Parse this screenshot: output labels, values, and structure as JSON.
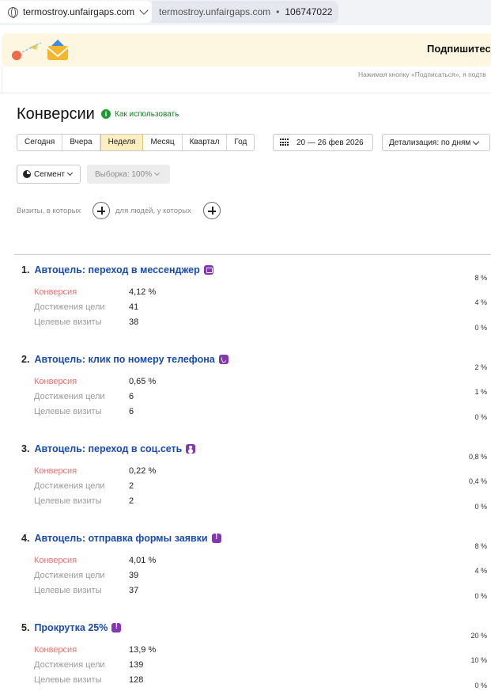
{
  "topbar": {
    "site": "termostroy.unfairgaps.com",
    "counter_site": "termostroy.unfairgaps.com",
    "counter_sep": "•",
    "counter_id": "106747022"
  },
  "banner": {
    "title": "Подпишитесь",
    "note": "Нажимая кнопку «Подписаться», я подтв"
  },
  "page": {
    "title": "Конверсии",
    "howto": "Как использовать",
    "howto_icon": "i"
  },
  "periods": [
    {
      "label": "Сегодня",
      "active": false
    },
    {
      "label": "Вчера",
      "active": false
    },
    {
      "label": "Неделя",
      "active": true
    },
    {
      "label": "Месяц",
      "active": false
    },
    {
      "label": "Квартал",
      "active": false
    },
    {
      "label": "Год",
      "active": false
    }
  ],
  "date_range": "20 — 26 фев 2026",
  "detail": "Детализация: по дням",
  "segment_label": "Сегмент",
  "sample_label": "Выборка: 100%",
  "filters": {
    "visits_text": "Визиты, в которых",
    "people_text": "для людей, у которых"
  },
  "metric_labels": {
    "conversion": "Конверсия",
    "reaches": "Достижения цели",
    "visits": "Целевые визиты"
  },
  "goals": [
    {
      "num": "1.",
      "name": "Автоцель: переход в мессенджер",
      "icon": "message-icon",
      "conversion": "4,12 %",
      "reaches": "41",
      "visits": "38",
      "axis": [
        "8 %",
        "4 %",
        "0 %"
      ]
    },
    {
      "num": "2.",
      "name": "Автоцель: клик по номеру телефона",
      "icon": "phone-icon",
      "conversion": "0,65 %",
      "reaches": "6",
      "visits": "6",
      "axis": [
        "2 %",
        "1 %",
        "0 %"
      ]
    },
    {
      "num": "3.",
      "name": "Автоцель: переход в соц.сеть",
      "icon": "user-icon",
      "conversion": "0,22 %",
      "reaches": "2",
      "visits": "2",
      "axis": [
        "0,8 %",
        "0,4 %",
        "0 %"
      ]
    },
    {
      "num": "4.",
      "name": "Автоцель: отправка формы заявки",
      "icon": "warning-icon",
      "conversion": "4,01 %",
      "reaches": "39",
      "visits": "37",
      "axis": [
        "8 %",
        "4 %",
        "0 %"
      ]
    },
    {
      "num": "5.",
      "name": "Прокрутка 25%",
      "icon": "warning-icon",
      "conversion": "13,9 %",
      "reaches": "139",
      "visits": "128",
      "axis": [
        "20 %",
        "10 %",
        "0 %"
      ]
    }
  ],
  "colors": {
    "accent_active": "#fdeec0",
    "goal_link": "#1a4bab",
    "badge": "#8338ad",
    "conversion_label": "#d67b7b",
    "howto": "#157a22"
  }
}
